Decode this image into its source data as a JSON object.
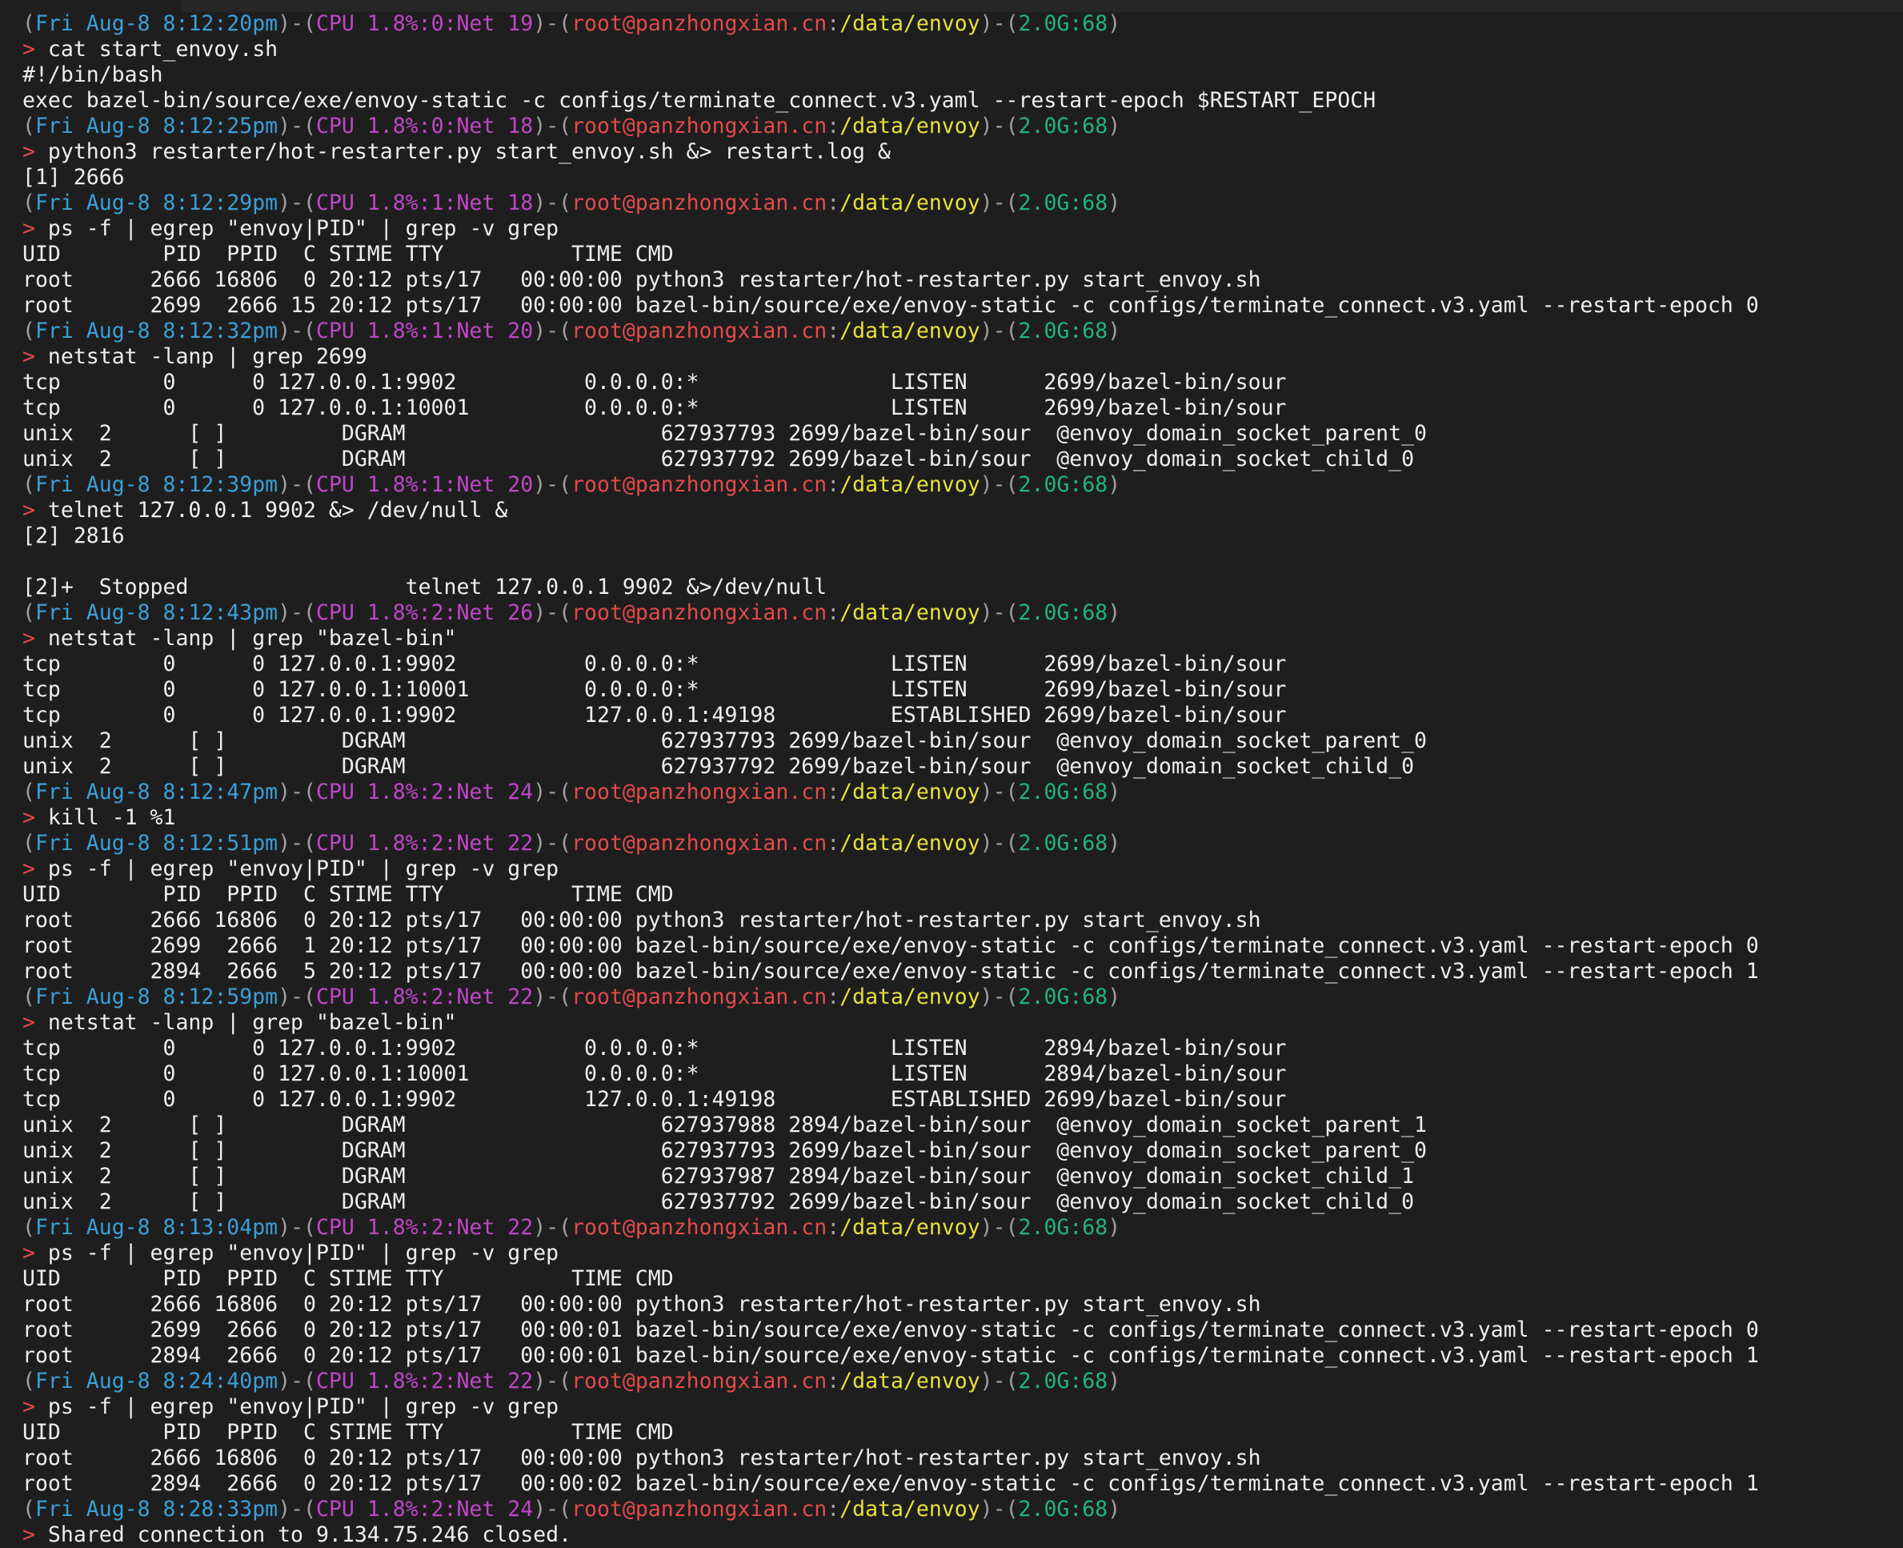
{
  "terminal": {
    "lines": [
      {
        "type": "prompt",
        "date": "Fri Aug-8 8:12:20pm",
        "cpu": "CPU 1.8%:0:Net 19",
        "user": "root@panzhongxian.cn",
        "path": "/data/envoy",
        "mem": "2.0G:68"
      },
      {
        "type": "cmd",
        "text": "cat start_envoy.sh"
      },
      {
        "type": "out",
        "text": "#!/bin/bash"
      },
      {
        "type": "out",
        "text": "exec bazel-bin/source/exe/envoy-static -c configs/terminate_connect.v3.yaml --restart-epoch $RESTART_EPOCH"
      },
      {
        "type": "prompt",
        "date": "Fri Aug-8 8:12:25pm",
        "cpu": "CPU 1.8%:0:Net 18",
        "user": "root@panzhongxian.cn",
        "path": "/data/envoy",
        "mem": "2.0G:68"
      },
      {
        "type": "cmd",
        "text": "python3 restarter/hot-restarter.py start_envoy.sh &> restart.log &"
      },
      {
        "type": "out",
        "text": "[1] 2666"
      },
      {
        "type": "prompt",
        "date": "Fri Aug-8 8:12:29pm",
        "cpu": "CPU 1.8%:1:Net 18",
        "user": "root@panzhongxian.cn",
        "path": "/data/envoy",
        "mem": "2.0G:68"
      },
      {
        "type": "cmd",
        "text": "ps -f | egrep \"envoy|PID\" | grep -v grep"
      },
      {
        "type": "out",
        "text": "UID        PID  PPID  C STIME TTY          TIME CMD"
      },
      {
        "type": "out",
        "text": "root      2666 16806  0 20:12 pts/17   00:00:00 python3 restarter/hot-restarter.py start_envoy.sh"
      },
      {
        "type": "out",
        "text": "root      2699  2666 15 20:12 pts/17   00:00:00 bazel-bin/source/exe/envoy-static -c configs/terminate_connect.v3.yaml --restart-epoch 0"
      },
      {
        "type": "prompt",
        "date": "Fri Aug-8 8:12:32pm",
        "cpu": "CPU 1.8%:1:Net 20",
        "user": "root@panzhongxian.cn",
        "path": "/data/envoy",
        "mem": "2.0G:68"
      },
      {
        "type": "cmd",
        "text": "netstat -lanp | grep 2699"
      },
      {
        "type": "out",
        "text": "tcp        0      0 127.0.0.1:9902          0.0.0.0:*               LISTEN      2699/bazel-bin/sour"
      },
      {
        "type": "out",
        "text": "tcp        0      0 127.0.0.1:10001         0.0.0.0:*               LISTEN      2699/bazel-bin/sour"
      },
      {
        "type": "out",
        "text": "unix  2      [ ]         DGRAM                    627937793 2699/bazel-bin/sour  @envoy_domain_socket_parent_0"
      },
      {
        "type": "out",
        "text": "unix  2      [ ]         DGRAM                    627937792 2699/bazel-bin/sour  @envoy_domain_socket_child_0"
      },
      {
        "type": "prompt",
        "date": "Fri Aug-8 8:12:39pm",
        "cpu": "CPU 1.8%:1:Net 20",
        "user": "root@panzhongxian.cn",
        "path": "/data/envoy",
        "mem": "2.0G:68"
      },
      {
        "type": "cmd",
        "text": "telnet 127.0.0.1 9902 &> /dev/null &"
      },
      {
        "type": "out",
        "text": "[2] 2816"
      },
      {
        "type": "out",
        "text": ""
      },
      {
        "type": "out",
        "text": "[2]+  Stopped                 telnet 127.0.0.1 9902 &>/dev/null"
      },
      {
        "type": "prompt",
        "date": "Fri Aug-8 8:12:43pm",
        "cpu": "CPU 1.8%:2:Net 26",
        "user": "root@panzhongxian.cn",
        "path": "/data/envoy",
        "mem": "2.0G:68"
      },
      {
        "type": "cmd",
        "text": "netstat -lanp | grep \"bazel-bin\""
      },
      {
        "type": "out",
        "text": "tcp        0      0 127.0.0.1:9902          0.0.0.0:*               LISTEN      2699/bazel-bin/sour"
      },
      {
        "type": "out",
        "text": "tcp        0      0 127.0.0.1:10001         0.0.0.0:*               LISTEN      2699/bazel-bin/sour"
      },
      {
        "type": "out",
        "text": "tcp        0      0 127.0.0.1:9902          127.0.0.1:49198         ESTABLISHED 2699/bazel-bin/sour"
      },
      {
        "type": "out",
        "text": "unix  2      [ ]         DGRAM                    627937793 2699/bazel-bin/sour  @envoy_domain_socket_parent_0"
      },
      {
        "type": "out",
        "text": "unix  2      [ ]         DGRAM                    627937792 2699/bazel-bin/sour  @envoy_domain_socket_child_0"
      },
      {
        "type": "prompt",
        "date": "Fri Aug-8 8:12:47pm",
        "cpu": "CPU 1.8%:2:Net 24",
        "user": "root@panzhongxian.cn",
        "path": "/data/envoy",
        "mem": "2.0G:68"
      },
      {
        "type": "cmd",
        "text": "kill -1 %1"
      },
      {
        "type": "prompt",
        "date": "Fri Aug-8 8:12:51pm",
        "cpu": "CPU 1.8%:2:Net 22",
        "user": "root@panzhongxian.cn",
        "path": "/data/envoy",
        "mem": "2.0G:68"
      },
      {
        "type": "cmd",
        "text": "ps -f | egrep \"envoy|PID\" | grep -v grep"
      },
      {
        "type": "out",
        "text": "UID        PID  PPID  C STIME TTY          TIME CMD"
      },
      {
        "type": "out",
        "text": "root      2666 16806  0 20:12 pts/17   00:00:00 python3 restarter/hot-restarter.py start_envoy.sh"
      },
      {
        "type": "out",
        "text": "root      2699  2666  1 20:12 pts/17   00:00:00 bazel-bin/source/exe/envoy-static -c configs/terminate_connect.v3.yaml --restart-epoch 0"
      },
      {
        "type": "out",
        "text": "root      2894  2666  5 20:12 pts/17   00:00:00 bazel-bin/source/exe/envoy-static -c configs/terminate_connect.v3.yaml --restart-epoch 1"
      },
      {
        "type": "prompt",
        "date": "Fri Aug-8 8:12:59pm",
        "cpu": "CPU 1.8%:2:Net 22",
        "user": "root@panzhongxian.cn",
        "path": "/data/envoy",
        "mem": "2.0G:68"
      },
      {
        "type": "cmd",
        "text": "netstat -lanp | grep \"bazel-bin\""
      },
      {
        "type": "out",
        "text": "tcp        0      0 127.0.0.1:9902          0.0.0.0:*               LISTEN      2894/bazel-bin/sour"
      },
      {
        "type": "out",
        "text": "tcp        0      0 127.0.0.1:10001         0.0.0.0:*               LISTEN      2894/bazel-bin/sour"
      },
      {
        "type": "out",
        "text": "tcp        0      0 127.0.0.1:9902          127.0.0.1:49198         ESTABLISHED 2699/bazel-bin/sour"
      },
      {
        "type": "out",
        "text": "unix  2      [ ]         DGRAM                    627937988 2894/bazel-bin/sour  @envoy_domain_socket_parent_1"
      },
      {
        "type": "out",
        "text": "unix  2      [ ]         DGRAM                    627937793 2699/bazel-bin/sour  @envoy_domain_socket_parent_0"
      },
      {
        "type": "out",
        "text": "unix  2      [ ]         DGRAM                    627937987 2894/bazel-bin/sour  @envoy_domain_socket_child_1"
      },
      {
        "type": "out",
        "text": "unix  2      [ ]         DGRAM                    627937792 2699/bazel-bin/sour  @envoy_domain_socket_child_0"
      },
      {
        "type": "prompt",
        "date": "Fri Aug-8 8:13:04pm",
        "cpu": "CPU 1.8%:2:Net 22",
        "user": "root@panzhongxian.cn",
        "path": "/data/envoy",
        "mem": "2.0G:68"
      },
      {
        "type": "cmd",
        "text": "ps -f | egrep \"envoy|PID\" | grep -v grep"
      },
      {
        "type": "out",
        "text": "UID        PID  PPID  C STIME TTY          TIME CMD"
      },
      {
        "type": "out",
        "text": "root      2666 16806  0 20:12 pts/17   00:00:00 python3 restarter/hot-restarter.py start_envoy.sh"
      },
      {
        "type": "out",
        "text": "root      2699  2666  0 20:12 pts/17   00:00:01 bazel-bin/source/exe/envoy-static -c configs/terminate_connect.v3.yaml --restart-epoch 0"
      },
      {
        "type": "out",
        "text": "root      2894  2666  0 20:12 pts/17   00:00:01 bazel-bin/source/exe/envoy-static -c configs/terminate_connect.v3.yaml --restart-epoch 1"
      },
      {
        "type": "prompt",
        "date": "Fri Aug-8 8:24:40pm",
        "cpu": "CPU 1.8%:2:Net 22",
        "user": "root@panzhongxian.cn",
        "path": "/data/envoy",
        "mem": "2.0G:68"
      },
      {
        "type": "cmd",
        "text": "ps -f | egrep \"envoy|PID\" | grep -v grep"
      },
      {
        "type": "out",
        "text": "UID        PID  PPID  C STIME TTY          TIME CMD"
      },
      {
        "type": "out",
        "text": "root      2666 16806  0 20:12 pts/17   00:00:00 python3 restarter/hot-restarter.py start_envoy.sh"
      },
      {
        "type": "out",
        "text": "root      2894  2666  0 20:12 pts/17   00:00:02 bazel-bin/source/exe/envoy-static -c configs/terminate_connect.v3.yaml --restart-epoch 1"
      },
      {
        "type": "prompt",
        "date": "Fri Aug-8 8:28:33pm",
        "cpu": "CPU 1.8%:2:Net 24",
        "user": "root@panzhongxian.cn",
        "path": "/data/envoy",
        "mem": "2.0G:68"
      },
      {
        "type": "cmd",
        "text": "Shared connection to 9.134.75.246 closed."
      }
    ]
  }
}
